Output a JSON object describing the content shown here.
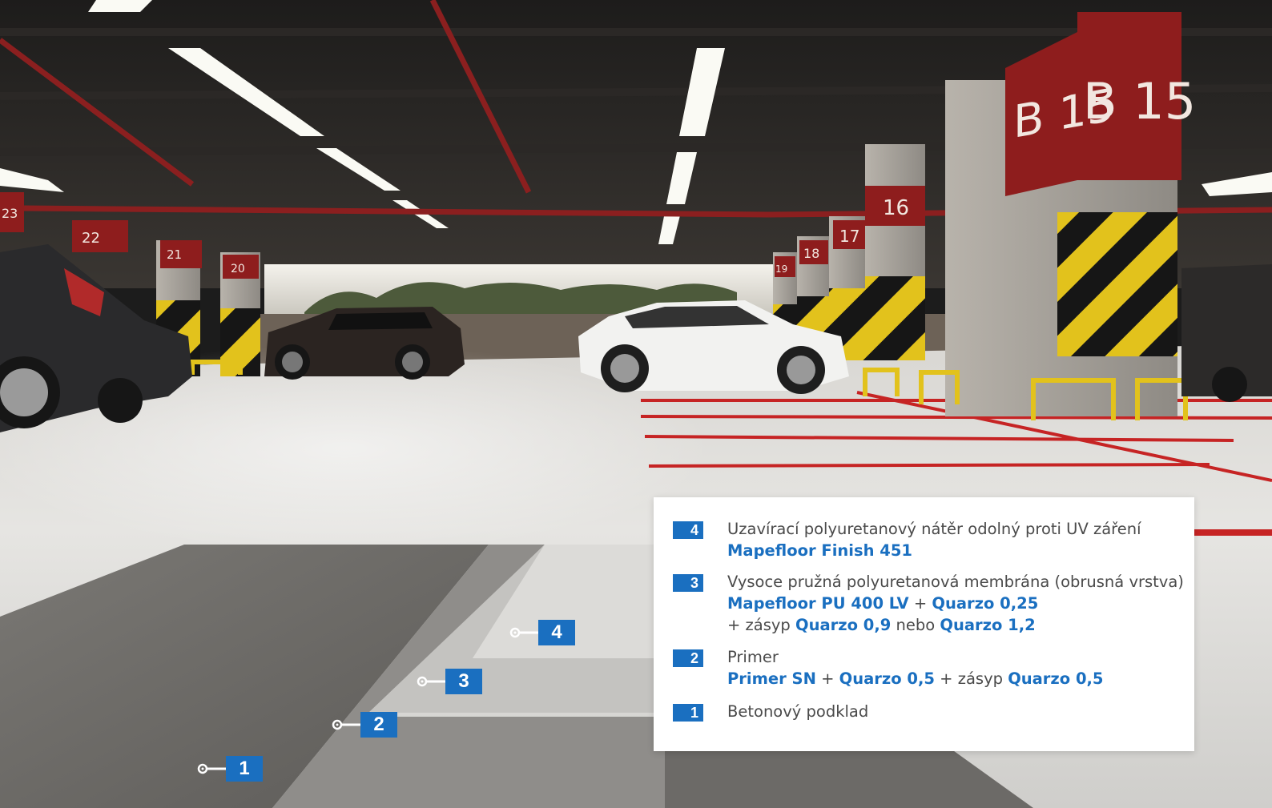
{
  "signs": {
    "big_1": "B 15",
    "big_2": "B 15",
    "p16": "16",
    "p17": "17",
    "p18": "18",
    "p19": "19",
    "p20": "20",
    "p21": "21",
    "p22": "22",
    "p23": "23"
  },
  "callouts": [
    {
      "number": "1"
    },
    {
      "number": "2"
    },
    {
      "number": "3"
    },
    {
      "number": "4"
    }
  ],
  "legend": {
    "items": [
      {
        "number": "4",
        "line1": "Uzavírací polyuretanový nátěr odolný proti UV záření",
        "product1": "Mapefloor Finish 451"
      },
      {
        "number": "3",
        "text1": "Vysoce pružná polyuretanová membrána (obrusná vrstva) ",
        "product1": "Mapefloor PU 400 LV",
        "plus1": " + ",
        "product2": "Quarzo 0,25",
        "text2": "+ zásyp ",
        "product3": "Quarzo 0,9",
        "text3": " nebo ",
        "product4": "Quarzo 1,2"
      },
      {
        "number": "2",
        "line1": "Primer",
        "product1": "Primer SN",
        "plus1": " + ",
        "product2": "Quarzo 0,5",
        "text2": " + zásyp ",
        "product3": "Quarzo 0,5"
      },
      {
        "number": "1",
        "line1": "Betonový podklad"
      }
    ]
  },
  "colors": {
    "brand_blue": "#1a6fc0",
    "sign_red": "#8e1d1d",
    "line_red": "#c62424",
    "hazard_yellow": "#e2c21c"
  }
}
